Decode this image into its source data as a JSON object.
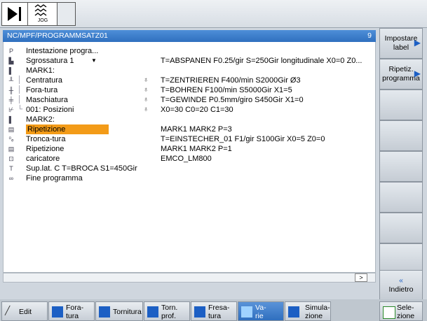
{
  "topbar": {
    "jog_label": "JOG"
  },
  "panel": {
    "path": "NC/MPF/PROGRAMMSATZ01",
    "count": "9"
  },
  "rows": [
    {
      "icon": "P",
      "label": "Intestazione progra...",
      "clip": "",
      "value": ""
    },
    {
      "icon": "",
      "label": "Sgrossatura 1",
      "clip": "",
      "value": "T=ABSPANEN F0.25/gir S=250Gir longitudinale X0=0 Z0..."
    },
    {
      "icon": "",
      "label": "MARK1:",
      "clip": "",
      "value": ""
    },
    {
      "icon": "",
      "label": "Centratura",
      "clip": "",
      "value": "T=ZENTRIEREN F400/min S2000Gir Ø3"
    },
    {
      "icon": "",
      "label": "Fora-tura",
      "clip": "",
      "value": "T=BOHREN F100/min S5000Gir X1=5"
    },
    {
      "icon": "",
      "label": "Maschiatura",
      "clip": "",
      "value": "T=GEWINDE P0.5mm/giro S450Gir X1=0"
    },
    {
      "icon": "",
      "label": "001: Posizioni",
      "clip": "",
      "value": "X0=30 C0=20 C1=30"
    },
    {
      "icon": "",
      "label": "MARK2:",
      "clip": "",
      "value": ""
    },
    {
      "icon": "",
      "label": "Ripetizione",
      "clip": "",
      "value": "MARK1 MARK2 P=3"
    },
    {
      "icon": "",
      "label": "Tronca-tura",
      "clip": "",
      "value": "T=EINSTECHER_01 F1/gir S100Gir X0=5 Z0=0"
    },
    {
      "icon": "",
      "label": "Ripetizione",
      "clip": "",
      "value": "MARK1 MARK2 P=1"
    },
    {
      "icon": "",
      "label": "caricatore",
      "clip": "",
      "value": "EMCO_LM800"
    },
    {
      "icon": "T",
      "label": "Sup.lat. C T=BROCA S1=450Gir",
      "clip": "",
      "value": ""
    },
    {
      "icon": "",
      "label": "Fine programma",
      "clip": "",
      "value": ""
    }
  ],
  "scroll_indicator": ">",
  "right_softkeys": {
    "label_line1": "Impostare",
    "label_line2": "label",
    "repeat_line1": "Ripetiz.",
    "repeat_line2": "programma",
    "back_arrows": "«",
    "back": "Indietro"
  },
  "bottom_softkeys": {
    "edit": "Edit",
    "drill_1": "Fora-",
    "drill_2": "tura",
    "turning": "Tornitura",
    "turn_prof_1": "Torn.",
    "turn_prof_2": "prof.",
    "mill_1": "Fresa-",
    "mill_2": "tura",
    "misc_1": "Va-",
    "misc_2": "rie",
    "sim_1": "Simula-",
    "sim_2": "zione",
    "sel_1": "Sele-",
    "sel_2": "zione"
  },
  "colors": {
    "titlebar": "#3a7dcc",
    "selection": "#f39b18",
    "accent": "#1c5fc4"
  },
  "selected_row": 8
}
